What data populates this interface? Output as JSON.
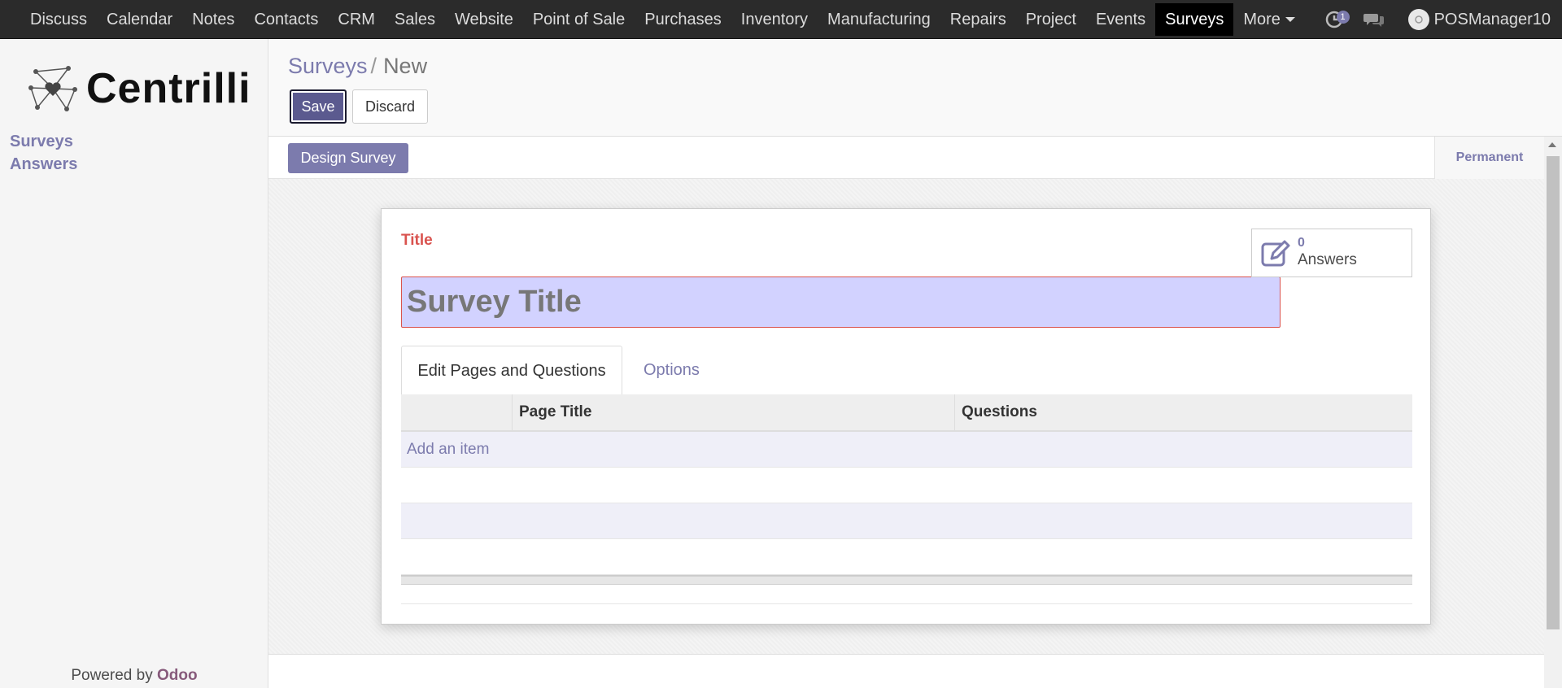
{
  "nav": {
    "items": [
      "Discuss",
      "Calendar",
      "Notes",
      "Contacts",
      "CRM",
      "Sales",
      "Website",
      "Point of Sale",
      "Purchases",
      "Inventory",
      "Manufacturing",
      "Repairs",
      "Project",
      "Events",
      "Surveys",
      "More"
    ],
    "active": "Surveys",
    "activity_badge": "1",
    "user": "POSManager10"
  },
  "sidebar": {
    "brand": "Centrilli",
    "links": [
      "Surveys",
      "Answers"
    ],
    "powered_prefix": "Powered by",
    "powered_brand": "Odoo"
  },
  "control": {
    "breadcrumb_root": "Surveys",
    "breadcrumb_sep": "/",
    "breadcrumb_current": "New",
    "save_label": "Save",
    "discard_label": "Discard"
  },
  "statusbar": {
    "design_label": "Design Survey",
    "stage": "Permanent"
  },
  "form": {
    "title_label": "Title",
    "title_placeholder": "Survey Title",
    "answers_count": "0",
    "answers_label": "Answers",
    "tabs": [
      "Edit Pages and Questions",
      "Options"
    ],
    "columns": [
      "Page Title",
      "Questions"
    ],
    "add_item": "Add an item"
  },
  "colors": {
    "accent": "#7c7bad",
    "nav_bg": "#2b2b2b",
    "required": "#d9534f",
    "title_input_bg": "#d2d2ff"
  }
}
